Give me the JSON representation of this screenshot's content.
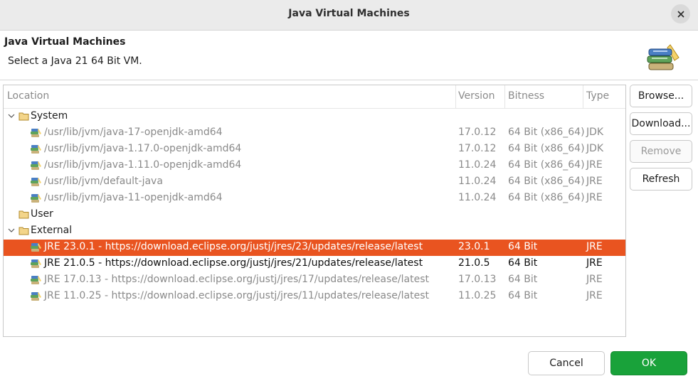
{
  "window": {
    "title": "Java Virtual Machines"
  },
  "header": {
    "title": "Java Virtual Machines",
    "message": "Select a Java 21 64 Bit VM."
  },
  "table": {
    "columns": [
      "Location",
      "Version",
      "Bitness",
      "Type"
    ],
    "groups": {
      "system": "System",
      "user": "User",
      "external": "External"
    },
    "system_rows": [
      {
        "location": "/usr/lib/jvm/java-17-openjdk-amd64",
        "version": "17.0.12",
        "bitness": "64 Bit (x86_64)",
        "type": "JDK"
      },
      {
        "location": "/usr/lib/jvm/java-1.17.0-openjdk-amd64",
        "version": "17.0.12",
        "bitness": "64 Bit (x86_64)",
        "type": "JDK"
      },
      {
        "location": "/usr/lib/jvm/java-1.11.0-openjdk-amd64",
        "version": "11.0.24",
        "bitness": "64 Bit (x86_64)",
        "type": "JRE"
      },
      {
        "location": "/usr/lib/jvm/default-java",
        "version": "11.0.24",
        "bitness": "64 Bit (x86_64)",
        "type": "JRE"
      },
      {
        "location": "/usr/lib/jvm/java-11-openjdk-amd64",
        "version": "11.0.24",
        "bitness": "64 Bit (x86_64)",
        "type": "JRE"
      }
    ],
    "external_rows": [
      {
        "location": "JRE 23.0.1 - https://download.eclipse.org/justj/jres/23/updates/release/latest",
        "version": "23.0.1",
        "bitness": "64 Bit",
        "type": "JRE"
      },
      {
        "location": "JRE 21.0.5 - https://download.eclipse.org/justj/jres/21/updates/release/latest",
        "version": "21.0.5",
        "bitness": "64 Bit",
        "type": "JRE"
      },
      {
        "location": "JRE 17.0.13 - https://download.eclipse.org/justj/jres/17/updates/release/latest",
        "version": "17.0.13",
        "bitness": "64 Bit",
        "type": "JRE"
      },
      {
        "location": "JRE 11.0.25 - https://download.eclipse.org/justj/jres/11/updates/release/latest",
        "version": "11.0.25",
        "bitness": "64 Bit",
        "type": "JRE"
      }
    ]
  },
  "side_buttons": {
    "browse": "Browse...",
    "download": "Download...",
    "remove": "Remove",
    "refresh": "Refresh"
  },
  "footer": {
    "cancel": "Cancel",
    "ok": "OK"
  },
  "colors": {
    "selection": "#e95420",
    "ok_button": "#19a23a"
  }
}
